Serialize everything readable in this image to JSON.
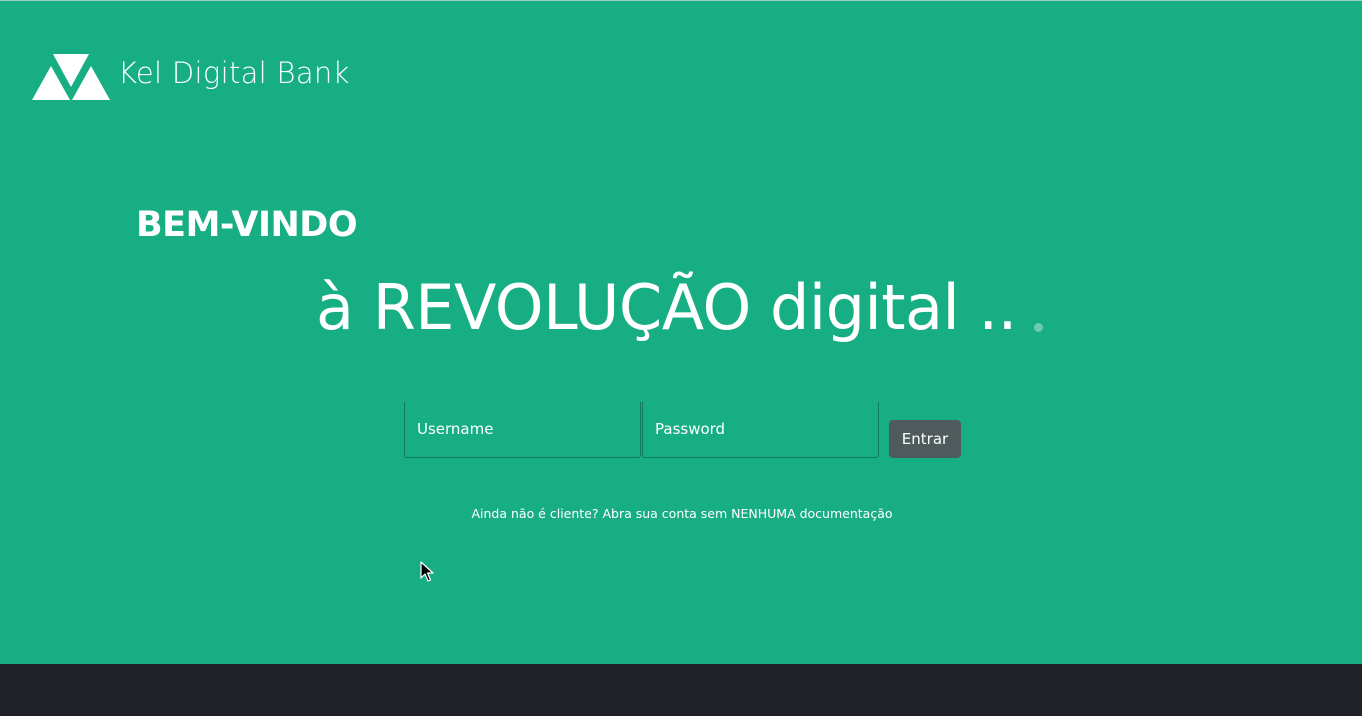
{
  "brand": {
    "name": "Kel Digital Bank",
    "logo_icon": "kel-triangles-logo-icon"
  },
  "hero": {
    "welcome": "BEM-VINDO",
    "headline": "à REVOLUÇÃO digital ..",
    "typing_indicator_icon": "dot-icon"
  },
  "login": {
    "username_placeholder": "Username",
    "password_placeholder": "Password",
    "submit_label": "Entrar"
  },
  "signup": {
    "text": "Ainda não é cliente? Abra sua conta sem NENHUMA documentação"
  },
  "colors": {
    "background": "#18ae84",
    "footer": "#202227",
    "button": "#4e5a5c",
    "text": "#ffffff"
  }
}
